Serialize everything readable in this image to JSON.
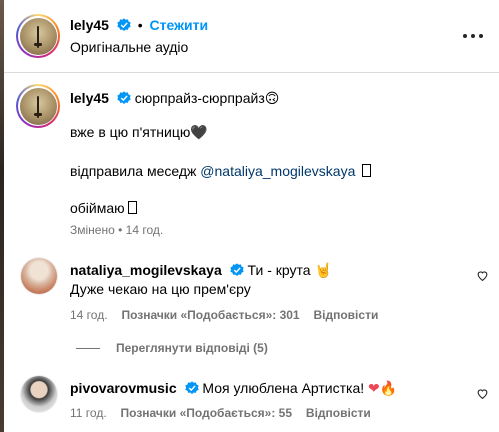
{
  "header": {
    "username": "lely45",
    "follow_label": "Стежити",
    "audio_label": "Оригінальне аудіо"
  },
  "caption": {
    "username": "lely45",
    "line1": "сюрпрайз-сюрпрайз",
    "line1_emoji": "🙃",
    "line2": "вже в цю п'ятницю",
    "line2_emoji": "🖤",
    "line3_prefix": "відправила меседж",
    "line3_mention": "@nataliya_mogilevskaya",
    "line4": "обіймаю",
    "edited_label": "Змінено",
    "time": "14 год."
  },
  "comments": [
    {
      "username": "nataliya_mogilevskaya",
      "text": "Ти - крута",
      "emoji": "🤘",
      "text2": "Дуже чекаю на цю прем'єру",
      "time": "14 год.",
      "likes_label": "Позначки «Подобається»: 301",
      "reply_label": "Відповісти",
      "view_replies_label": "Переглянути відповіді (5)"
    },
    {
      "username": "pivovarovmusic",
      "text": "Моя улюблена Артистка!",
      "emoji": "❤🔥",
      "time": "11 год.",
      "likes_label": "Позначки «Подобається»: 55",
      "reply_label": "Відповісти"
    }
  ],
  "colors": {
    "blue": "#0095f6",
    "verified": "#0095f6",
    "muted": "#737373",
    "mention": "#00376b"
  },
  "icons": [
    "verified-badge-icon",
    "more-options-icon",
    "heart-icon"
  ]
}
